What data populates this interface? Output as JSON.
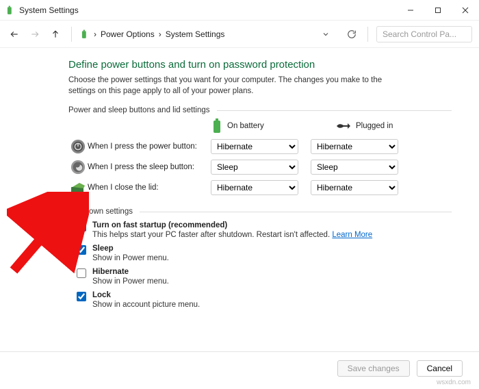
{
  "window": {
    "title": "System Settings"
  },
  "breadcrumb": {
    "item1": "Power Options",
    "item2": "System Settings"
  },
  "search": {
    "placeholder": "Search Control Pa..."
  },
  "page": {
    "heading": "Define power buttons and turn on password protection",
    "subtext": "Choose the power settings that you want for your computer. The changes you make to the settings on this page apply to all of your power plans.",
    "section1_label": "Power and sleep buttons and lid settings",
    "col_battery": "On battery",
    "col_plugged": "Plugged in",
    "row_power_label": "When I press the power button:",
    "row_sleep_label": "When I press the sleep button:",
    "row_lid_label": "When I close the lid:",
    "selects": {
      "power_battery": "Hibernate",
      "power_plugged": "Hibernate",
      "sleep_battery": "Sleep",
      "sleep_plugged": "Sleep",
      "lid_battery": "Hibernate",
      "lid_plugged": "Hibernate"
    },
    "section2_label": "Shutdown settings",
    "shutdown": {
      "fast_title": "Turn on fast startup (recommended)",
      "fast_desc": "This helps start your PC faster after shutdown. Restart isn't affected. ",
      "learn_more": "Learn More",
      "sleep_title": "Sleep",
      "sleep_desc": "Show in Power menu.",
      "hibernate_title": "Hibernate",
      "hibernate_desc": "Show in Power menu.",
      "lock_title": "Lock",
      "lock_desc": "Show in account picture menu."
    }
  },
  "footer": {
    "save": "Save changes",
    "cancel": "Cancel"
  },
  "watermark": "wsxdn.com"
}
